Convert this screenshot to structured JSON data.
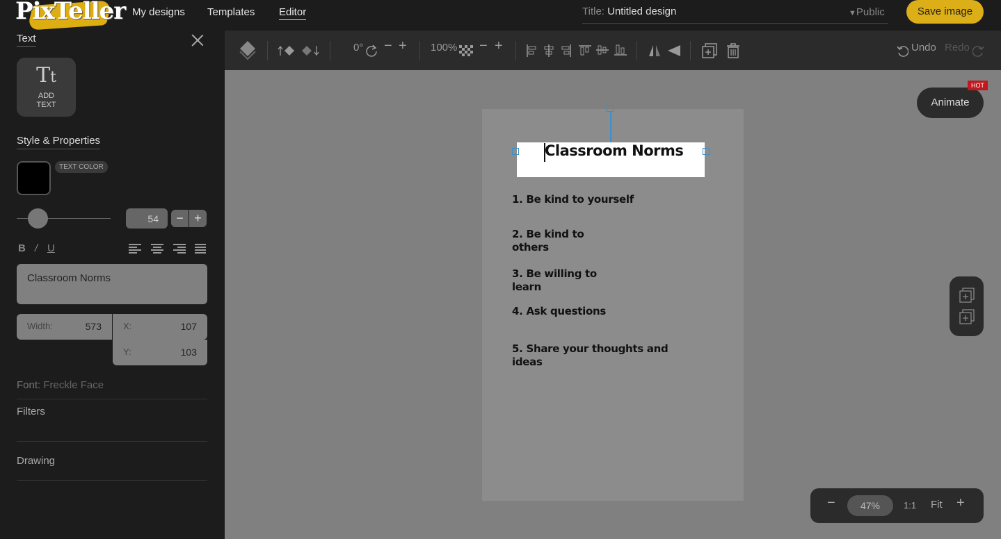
{
  "app": {
    "logo_text": "PixTeller"
  },
  "nav": {
    "my_designs": "My designs",
    "templates": "Templates",
    "editor": "Editor"
  },
  "title": {
    "label": "Title:",
    "value": "Untitled design"
  },
  "visibility": "Public",
  "save_label": "Save image",
  "panel": {
    "title": "Text",
    "add_text_label_1": "ADD",
    "add_text_label_2": "TEXT",
    "style_title": "Style & Properties",
    "text_color_label": "TEXT COLOR",
    "text_color": "#000000",
    "font_size": "54",
    "bold": "B",
    "italic": "/",
    "underline": "U",
    "text_value": "Classroom Norms",
    "width_label": "Width:",
    "width_value": "573",
    "x_label": "X:",
    "x_value": "107",
    "y_label": "Y:",
    "y_value": "103",
    "font_label": "Font:",
    "font_value": "Freckle Face",
    "filters": "Filters",
    "drawing": "Drawing"
  },
  "toolbar": {
    "rotation": "0°",
    "opacity": "100%",
    "undo": "Undo",
    "redo": "Redo"
  },
  "canvas": {
    "heading": "Classroom Norms",
    "norms": [
      {
        "line1": "1. Be kind to yourself",
        "line2": ""
      },
      {
        "line1": "2. Be kind to",
        "line2": "others"
      },
      {
        "line1": "3. Be willing to",
        "line2": "learn"
      },
      {
        "line1": "4. Ask questions",
        "line2": ""
      },
      {
        "line1": "5. Share your thoughts and",
        "line2": "ideas"
      }
    ]
  },
  "animate": {
    "label": "Animate",
    "badge": "HOT"
  },
  "zoom": {
    "value": "47%",
    "one_to_one": "1:1",
    "fit": "Fit"
  },
  "colors": {
    "accent": "#dcae18",
    "selection": "#3d8fc9",
    "badge": "#c0181e"
  }
}
